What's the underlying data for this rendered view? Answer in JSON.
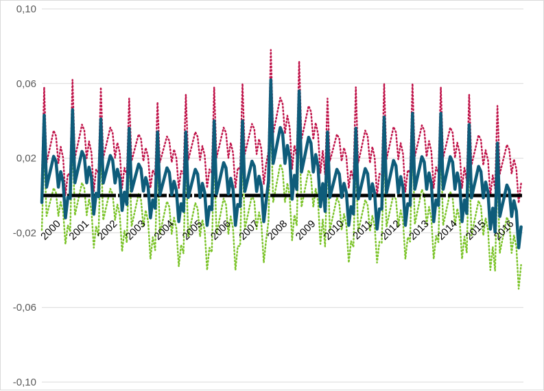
{
  "chart_data": {
    "type": "line",
    "title": "",
    "xlabel": "",
    "ylabel": "",
    "ylim": [
      -0.1,
      0.1
    ],
    "ytick_values": [
      0.1,
      0.06,
      0.02,
      -0.02,
      -0.06,
      -0.1
    ],
    "ytick_labels": [
      "0,10",
      "0,06",
      "0,02",
      "-0,02",
      "-0,06",
      "-0,10"
    ],
    "x_range": [
      2000,
      2017
    ],
    "years": [
      "2000",
      "2001",
      "2002",
      "2003",
      "2004",
      "2005",
      "2006",
      "2007",
      "2008",
      "2009",
      "2010",
      "2011",
      "2012",
      "2013",
      "2014",
      "2015",
      "2016"
    ],
    "grid": true,
    "legend": "none",
    "series": [
      {
        "style": "dotted",
        "color": "#c0144a",
        "peaks": [
          0.058,
          0.062,
          0.058,
          0.052,
          0.05,
          0.054,
          0.058,
          0.06,
          0.078,
          0.072,
          0.052,
          0.058,
          0.06,
          0.06,
          0.058,
          0.054,
          0.048,
          0.036
        ],
        "troughs": [
          0.0,
          0.002,
          0.004,
          0.004,
          0.004,
          0.004,
          0.004,
          0.006,
          0.014,
          0.012,
          0.004,
          0.0,
          0.002,
          0.004,
          0.004,
          0.0,
          -0.004,
          -0.01
        ]
      },
      {
        "style": "solid",
        "color": "#0e5c7a",
        "peaks": [
          0.043,
          0.046,
          0.041,
          0.036,
          0.034,
          0.034,
          0.04,
          0.04,
          0.062,
          0.056,
          0.034,
          0.036,
          0.042,
          0.044,
          0.044,
          0.038,
          0.028,
          0.018
        ],
        "troughs": [
          -0.012,
          -0.01,
          -0.008,
          -0.012,
          -0.014,
          -0.016,
          -0.016,
          -0.014,
          -0.002,
          -0.006,
          -0.016,
          -0.018,
          -0.016,
          -0.014,
          -0.014,
          -0.018,
          -0.028,
          -0.04
        ]
      },
      {
        "style": "dotted",
        "color": "#7cc42a",
        "peaks": [
          0.024,
          0.03,
          0.026,
          0.024,
          0.02,
          0.02,
          0.024,
          0.024,
          0.044,
          0.04,
          0.022,
          0.02,
          0.024,
          0.028,
          0.026,
          0.022,
          0.014,
          0.004
        ],
        "troughs": [
          -0.026,
          -0.028,
          -0.03,
          -0.034,
          -0.038,
          -0.04,
          -0.04,
          -0.036,
          -0.024,
          -0.026,
          -0.036,
          -0.036,
          -0.034,
          -0.034,
          -0.034,
          -0.04,
          -0.05,
          -0.058
        ]
      },
      {
        "style": "solid",
        "color": "#000000",
        "value": 0.0
      }
    ]
  }
}
